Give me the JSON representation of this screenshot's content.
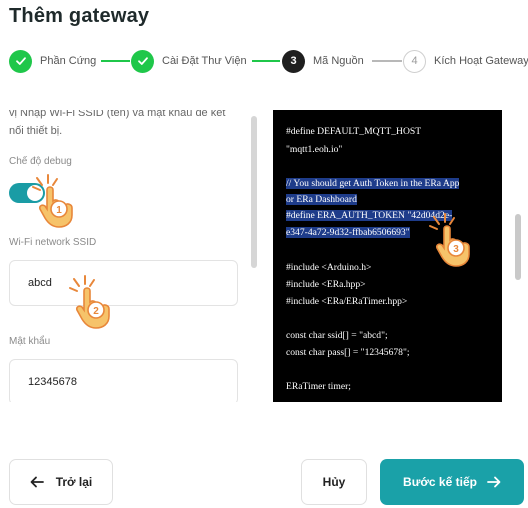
{
  "page": {
    "title": "Thêm gateway"
  },
  "stepper": {
    "steps": [
      {
        "label": "Phần Cứng",
        "number": "",
        "status": "done"
      },
      {
        "label": "Cài Đặt Thư Viện",
        "number": "",
        "status": "done"
      },
      {
        "label": "Mã Nguồn",
        "number": "3",
        "status": "active"
      },
      {
        "label": "Kích Hoạt Gateway",
        "number": "4",
        "status": "todo"
      }
    ]
  },
  "form": {
    "intro_text": "vị Nhập Wi-Fi SSID (tên) và mật khẩu để kết nối thiết bị.",
    "debug_label": "Chế độ debug",
    "debug_enabled": true,
    "ssid_label": "Wi-Fi network SSID",
    "ssid_value": "abcd",
    "password_label": "Mật khẩu",
    "password_value": "12345678"
  },
  "code": {
    "lines": [
      "#define DEFAULT_MQTT_HOST",
      "\"mqtt1.eoh.io\"",
      "",
      "// You should get Auth Token in the ERa App",
      "or ERa Dashboard",
      "#define ERA_AUTH_TOKEN \"42d04d2e-",
      "e347-4a72-9d32-ffbab6506693\"",
      "",
      "#include <Arduino.h>",
      "#include <ERa.hpp>",
      "#include <ERa/ERaTimer.hpp>",
      "",
      "const char ssid[] = \"abcd\";",
      "const char pass[] = \"12345678\";",
      "",
      "ERaTimer timer;"
    ]
  },
  "markers": [
    "1",
    "2",
    "3"
  ],
  "footer": {
    "back_label": "Trở lại",
    "cancel_label": "Hủy",
    "next_label": "Bước kế tiếp"
  },
  "colors": {
    "step_done": "#1fc74a",
    "step_active": "#1f1f1f",
    "toggle_on": "#1a9ca5",
    "primary_button": "#1aa1a8",
    "code_background": "#000000",
    "code_highlight": "#1e3c8a",
    "marker_fill": "#f6c36a"
  }
}
